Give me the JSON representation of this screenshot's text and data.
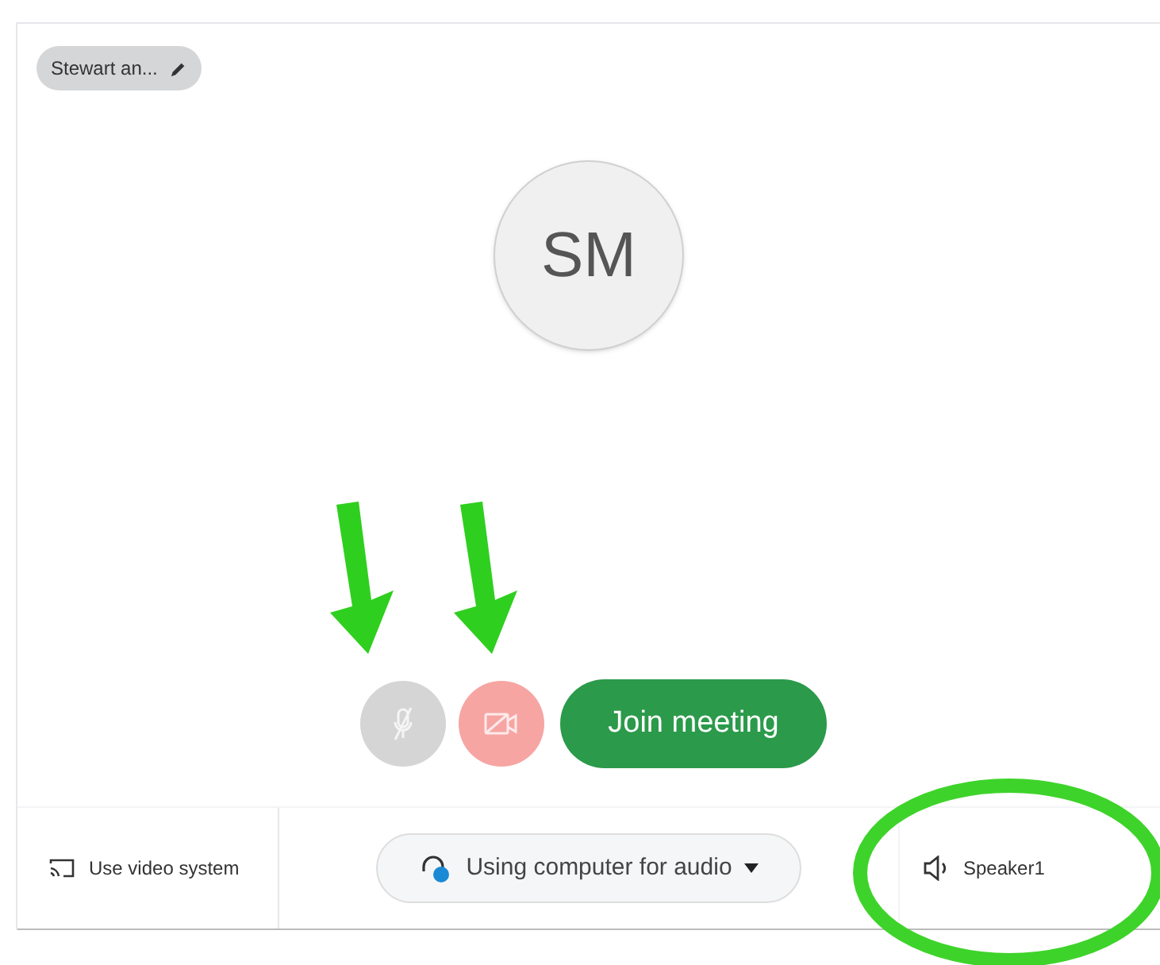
{
  "name_tag": {
    "label": "Stewart an..."
  },
  "avatar": {
    "initials": "SM"
  },
  "controls": {
    "microphone_muted": true,
    "camera_off": true,
    "join_button": "Join meeting"
  },
  "bottom_bar": {
    "video_system": "Use video system",
    "audio": "Using computer for audio",
    "speaker": "Speaker1"
  }
}
